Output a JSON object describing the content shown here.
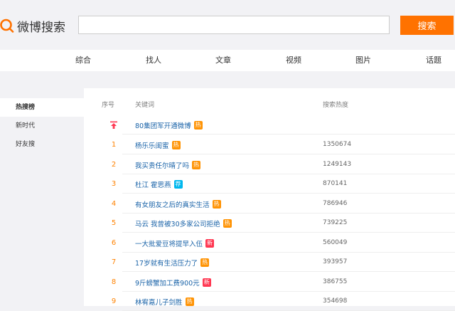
{
  "header": {
    "logo_text": "微博搜索",
    "search_placeholder": "",
    "search_button": "搜索"
  },
  "tabs": [
    "综合",
    "找人",
    "文章",
    "视频",
    "图片",
    "话题"
  ],
  "sidebar": {
    "items": [
      {
        "label": "热搜榜",
        "active": true
      },
      {
        "label": "新时代",
        "active": false
      },
      {
        "label": "好友搜",
        "active": false
      }
    ]
  },
  "table": {
    "headers": {
      "rank": "序号",
      "keyword": "关键词",
      "heat": "搜索热度"
    },
    "rows": [
      {
        "rank": "",
        "keyword": "80集团军开通微博",
        "badge": "热",
        "badge_color": "#ff9406",
        "heat": ""
      },
      {
        "rank": "1",
        "keyword": "杨乐乐闺蜜",
        "badge": "热",
        "badge_color": "#ff9406",
        "heat": "1350674"
      },
      {
        "rank": "2",
        "keyword": "我买贵任尔晴了吗",
        "badge": "热",
        "badge_color": "#ff9406",
        "heat": "1249143"
      },
      {
        "rank": "3",
        "keyword": "杜江 霍思燕",
        "badge": "荐",
        "badge_color": "#00b7ee",
        "heat": "870141"
      },
      {
        "rank": "4",
        "keyword": "有女朋友之后的真实生活",
        "badge": "热",
        "badge_color": "#ff9406",
        "heat": "786946"
      },
      {
        "rank": "5",
        "keyword": "马云 我曾被30多家公司拒绝",
        "badge": "热",
        "badge_color": "#ff9406",
        "heat": "739225"
      },
      {
        "rank": "6",
        "keyword": "一大批爱豆将提早入伍",
        "badge": "新",
        "badge_color": "#ff3852",
        "heat": "560049"
      },
      {
        "rank": "7",
        "keyword": "17岁就有生活压力了",
        "badge": "热",
        "badge_color": "#ff9406",
        "heat": "393957"
      },
      {
        "rank": "8",
        "keyword": "9斤螃蟹加工费900元",
        "badge": "新",
        "badge_color": "#ff3852",
        "heat": "386755"
      },
      {
        "rank": "9",
        "keyword": "林宥嘉儿子剑胜",
        "badge": "热",
        "badge_color": "#ff9406",
        "heat": "354698"
      }
    ]
  },
  "icons": {
    "logo": "search-magnifier-icon",
    "top_pin": "pin-top-icon"
  },
  "colors": {
    "accent": "#ff7200",
    "rank": "#ff8200",
    "link": "#1a63a8",
    "hot_badge": "#ff9406",
    "new_badge": "#ff3852",
    "recommend_badge": "#00b7ee"
  }
}
